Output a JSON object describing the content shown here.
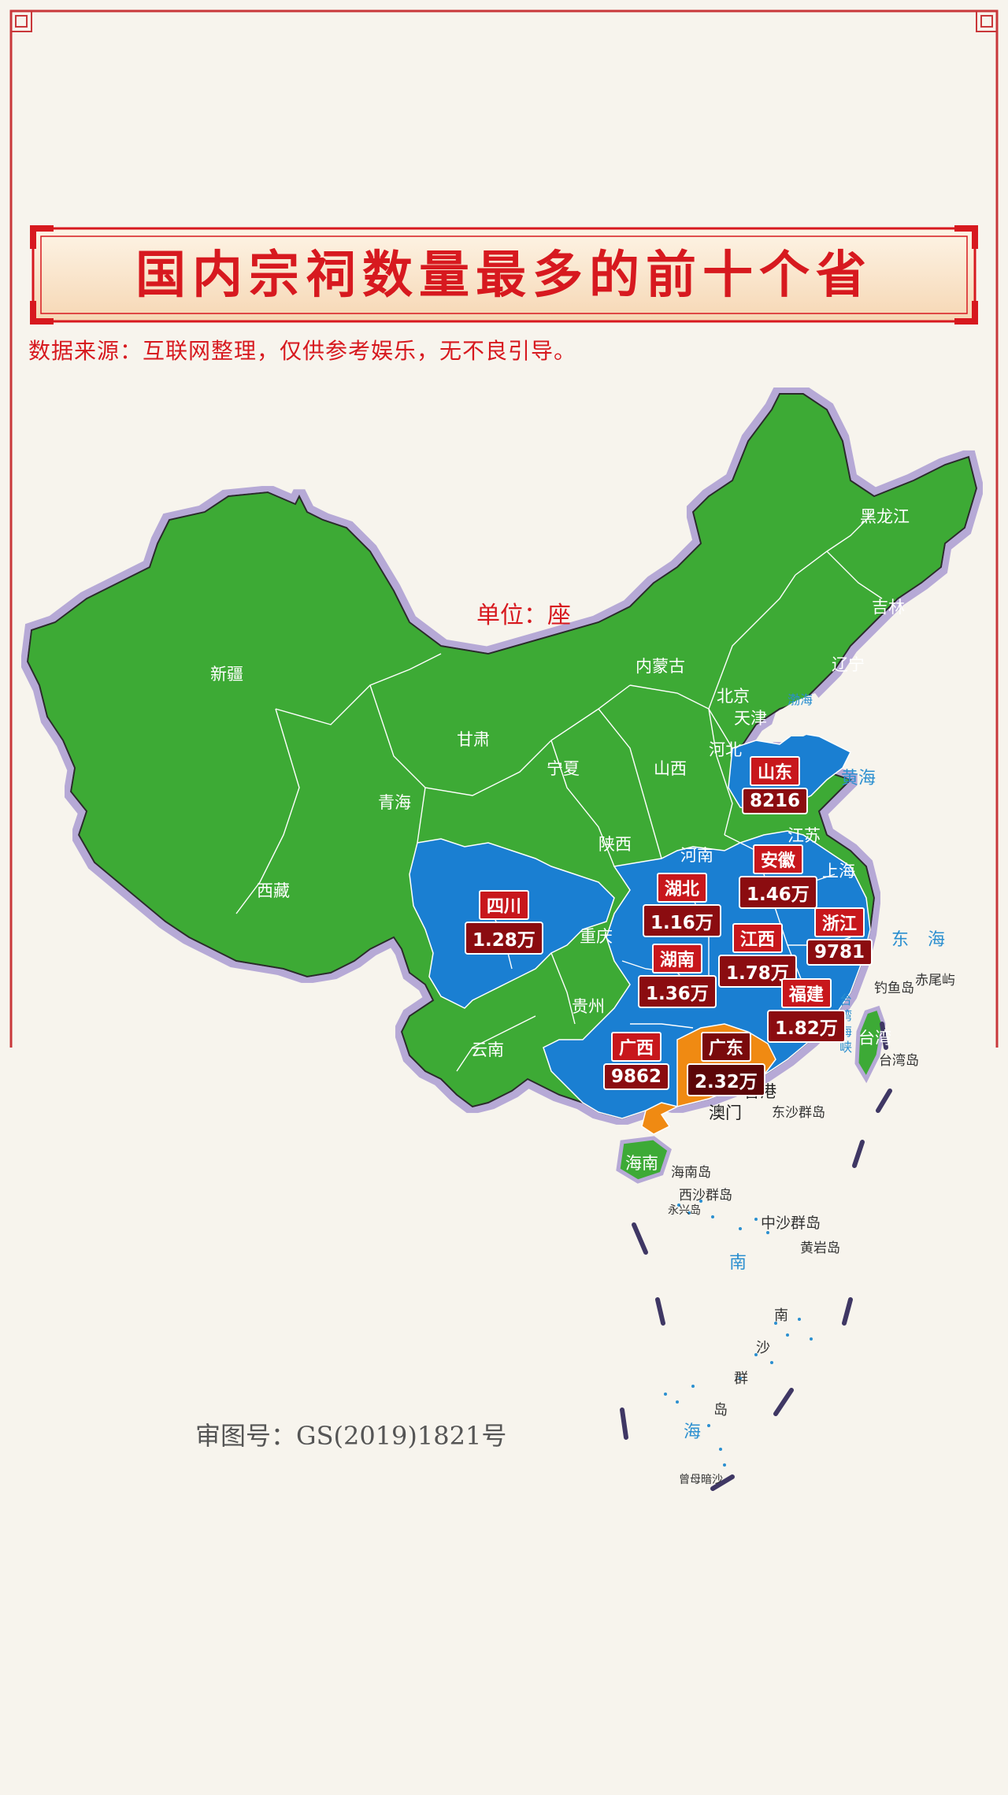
{
  "title": "国内宗祠数量最多的前十个省",
  "source_note": "数据来源：互联网整理，仅供参考娱乐，无不良引导。",
  "unit_label": "单位：座",
  "approval_no": "审图号：GS(2019)1821号",
  "colors": {
    "other_provinces": "#3daa36",
    "top_ten": "#1a7fd2",
    "first_place": "#f08a12",
    "border_glow": "#b6a9d6",
    "title_red": "#d7191f",
    "label_bg": "#c8171c"
  },
  "ranked_provinces": [
    {
      "name": "广东",
      "value": "2.32万"
    },
    {
      "name": "福建",
      "value": "1.82万"
    },
    {
      "name": "江西",
      "value": "1.78万"
    },
    {
      "name": "安徽",
      "value": "1.46万"
    },
    {
      "name": "湖南",
      "value": "1.36万"
    },
    {
      "name": "四川",
      "value": "1.28万"
    },
    {
      "name": "湖北",
      "value": "1.16万"
    },
    {
      "name": "广西",
      "value": "9862"
    },
    {
      "name": "浙江",
      "value": "9781"
    },
    {
      "name": "山东",
      "value": "8216"
    }
  ],
  "province_labels": {
    "heilongjiang": "黑龙江",
    "jilin": "吉林",
    "liaoning": "辽宁",
    "neimenggu": "内蒙古",
    "beijing": "北京",
    "tianjin": "天津",
    "hebei": "河北",
    "shanxi": "山西",
    "xinjiang": "新疆",
    "gansu": "甘肃",
    "ningxia": "宁夏",
    "qinghai": "青海",
    "shaanxi": "陕西",
    "henan": "河南",
    "jiangsu": "江苏",
    "shanghai": "上海",
    "xizang": "西藏",
    "chongqing": "重庆",
    "guizhou": "贵州",
    "yunnan": "云南",
    "taiwan": "台湾",
    "hainan": "海南",
    "xianggang": "香港",
    "aomen": "澳门"
  },
  "sea_labels": {
    "bohai": "渤海",
    "huanghai": "黄海",
    "donghai": "东海",
    "taiwan_strait": "台湾海峡",
    "nanhai_1": "南",
    "nanhai_sea": "南海",
    "nansha_1": "南",
    "nansha_2": "沙",
    "nansha_3": "群",
    "nansha_4": "岛",
    "nansha_5": "海"
  },
  "island_labels": {
    "diaoyu": "钓鱼岛",
    "chiwei": "赤尾屿",
    "taiwan_dao": "台湾岛",
    "dongsha": "东沙群岛",
    "hainan_dao": "海南岛",
    "xisha": "西沙群岛",
    "yongxing": "永兴岛",
    "zhongsha": "中沙群岛",
    "huangyan": "黄岩岛",
    "zengmu": "曾母暗沙"
  }
}
